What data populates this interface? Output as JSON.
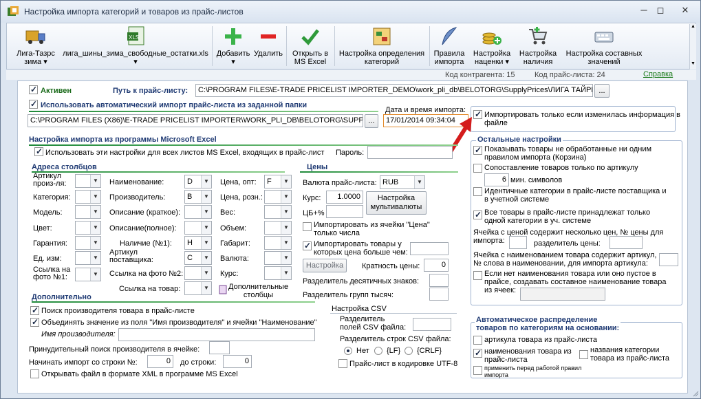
{
  "window": {
    "title": "Настройка импорта категорий и товаров из прайс-листов",
    "controls": [
      "─",
      "◻",
      "✕"
    ]
  },
  "toolbar": {
    "items": [
      {
        "label": "Лига-Тазрс\nзима ▾",
        "icon": "truck-icon"
      },
      {
        "label": "лига_шины_зима_свободные_остатки.xls\n▾",
        "icon": "xls-file-icon"
      },
      {
        "label": "Добавить\n▾",
        "icon": "plus-icon"
      },
      {
        "label": "Удалить",
        "icon": "minus-icon"
      },
      {
        "label": "Открыть в\nMS Excel",
        "icon": "checkmark-icon"
      },
      {
        "label": "Настройка определения\nкатегорий",
        "icon": "tree-icon"
      },
      {
        "label": "Правила\nимпорта",
        "icon": "feather-icon"
      },
      {
        "label": "Настройка\nнаценки ▾",
        "icon": "coins-icon"
      },
      {
        "label": "Настройка\nналичия",
        "icon": "cart-icon"
      },
      {
        "label": "Настройка составных\nзначений",
        "icon": "keyboard-icon"
      }
    ]
  },
  "infobar": {
    "contractor_code": "Код контрагента: 15",
    "pricelist_code": "Код прайс-листа: 24",
    "help_link": "Справка"
  },
  "general": {
    "active_label": "Активен",
    "path_label": "Путь к прайс-листу:",
    "path_value": "C:\\PROGRAM FILES\\E-TRADE PRICELIST IMPORTER_DEMO\\work_pli_db\\BELOTORG\\SupplyPrices\\ЛИГА ТАЙРЕС_ЗИМА",
    "browse": "...",
    "auto_import_label": "Использовать автоматический импорт прайс-листа из заданной папки",
    "folder_value": "C:\\PROGRAM FILES (X86)\\E-TRADE PRICELIST IMPORTER\\WORK_PLI_DB\\BELOTORG\\SUPPLYPRICI",
    "datetime_label": "Дата и время импорта:",
    "datetime_value": "17/01/2014 09:34:04",
    "import_if_changed_label": "Импортировать только если изменилась информация в файле"
  },
  "excel": {
    "section_title": "Настройка импорта из программы Microsoft Excel",
    "use_all_sheets_label": "Использовать эти настройки для всех листов MS Excel, входящих в прайс-лист",
    "password_label": "Пароль:",
    "addresses_title": "Адреса столбцов",
    "col1": [
      {
        "label": "Артикул\nпроиз-ля:",
        "value": ""
      },
      {
        "label": "Категория:",
        "value": ""
      },
      {
        "label": "Модель:",
        "value": ""
      },
      {
        "label": "Цвет:",
        "value": ""
      },
      {
        "label": "Гарантия:",
        "value": ""
      },
      {
        "label": "Ед. изм:",
        "value": ""
      },
      {
        "label": "Ссылка на\nфото №1:",
        "value": ""
      }
    ],
    "col2": [
      {
        "label": "Наименование:",
        "value": "D"
      },
      {
        "label": "Производитель:",
        "value": "B"
      },
      {
        "label": "Описание (краткое):",
        "value": ""
      },
      {
        "label": "Описание(полное):",
        "value": ""
      },
      {
        "label": "Наличие (№1):",
        "value": "H"
      },
      {
        "label": "Артикул\nпоставщика:",
        "value": "C"
      },
      {
        "label": "Ссылка на фото №2:",
        "value": ""
      },
      {
        "label": "Ссылка на товар:",
        "value": ""
      }
    ],
    "col3": [
      {
        "label": "Цена, опт:",
        "value": "F"
      },
      {
        "label": "Цена, розн.:",
        "value": ""
      },
      {
        "label": "Вес:",
        "value": ""
      },
      {
        "label": "Объем:",
        "value": ""
      },
      {
        "label": "Габарит:",
        "value": ""
      },
      {
        "label": "Валюта:",
        "value": ""
      },
      {
        "label": "Курс:",
        "value": ""
      }
    ],
    "extra_columns_label": "Дополнительные\nстолбцы",
    "prices_title": "Цены",
    "currency_label": "Валюта прайс-листа:",
    "currency_value": "RUB",
    "rate_label": "Курс:",
    "rate_value": "1.0000",
    "cb_pct_label": "ЦБ+%",
    "multicurrency_btn": "Настройка\nмультивалюты",
    "import_price_cell_label": "Импортировать из ячейки \"Цена\"\nтолько числа",
    "import_price_gt_label": "Импортировать товары у\nкоторых цена больше чем:",
    "settings_btn": "Настройка",
    "price_multiplicity_label": "Кратность цены:",
    "price_multiplicity_value": "0",
    "decimal_sep_label": "Разделитель десятичных знаков:",
    "thousand_sep_label": "Разделитель групп тысяч:"
  },
  "additional": {
    "title": "Дополнительно",
    "search_vendor_label": "Поиск производителя товара в прайс-листе",
    "merge_label": "Объединять значение из поля \"Имя производителя\" и ячейки \"Наименование\"",
    "vendor_name_label": "Имя производителя:",
    "forced_search_label": "Принудительный поиск производителя в ячейке:",
    "start_row_label": "Начинать импорт со строки №:",
    "start_row_value": "0",
    "to_row_label": "до строки:",
    "to_row_value": "0",
    "open_xml_label": "Открывать файл в формате XML в программе MS Excel"
  },
  "csv": {
    "title": "Настройка CSV",
    "field_sep_label": "Разделитель\nполей CSV файла:",
    "row_sep_label": "Разделитель строк CSV файла:",
    "options": [
      "Нет",
      "{LF}",
      "{CRLF}"
    ],
    "utf8_label": "Прайс-лист в кодировке UTF-8"
  },
  "other": {
    "title": "Остальные настройки",
    "show_unprocessed_label": "Показывать товары не обработанные ни одним\nправилом импорта (Корзина)",
    "match_by_article_label": "Сопоставление товаров только по артикулу",
    "min_chars_value": "6",
    "min_chars_label": "мин. символов",
    "identical_categories_label": "Идентичные категории в прайс-листе поставщика и\nв учетной системе",
    "all_goods_label": "Все товары в прайс-листе принадлежат только\nодной категории в уч. системе",
    "multiple_prices_label": "Ячейка с ценой содержит несколько цен, № цены для\nимпорта:",
    "price_sep_label": "разделитель цены:",
    "article_in_name_label": "Ячейка с наименованием товара содержит артикул,\n№ слова в наименовании, для импорта артикула:",
    "compose_name_label": "Если нет наименования товара или оно пустое в\nпрайсе, создавать составное наименование товара\nиз ячеек:"
  },
  "auto_distribution": {
    "title": "Автоматическое распределение\nтоваров по категориям на основании:",
    "by_article_label": "артикула товара из прайс-листа",
    "by_name_label": "наименования товара из\nпрайс-листа",
    "by_category_names_label": "названия категории\nтовара из прайс-листа",
    "apply_rules_label": "применить перед работой правил\nимпорта"
  }
}
